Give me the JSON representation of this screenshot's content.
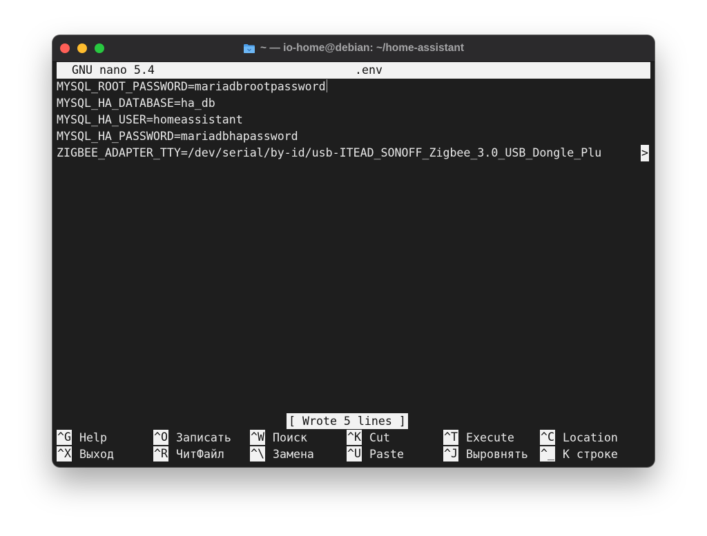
{
  "window": {
    "title": "~ — io-home@debian: ~/home-assistant",
    "title_icon": "folder-icon",
    "colors": {
      "close": "#ff5f57",
      "minimize": "#febc2e",
      "maximize": "#28c840"
    }
  },
  "nano": {
    "app": "GNU nano 5.4",
    "filename": ".env",
    "lines": [
      "MYSQL_ROOT_PASSWORD=mariadbrootpassword",
      "MYSQL_HA_DATABASE=ha_db",
      "MYSQL_HA_USER=homeassistant",
      "MYSQL_HA_PASSWORD=mariadbhapassword",
      "ZIGBEE_ADAPTER_TTY=/dev/serial/by-id/usb-ITEAD_SONOFF_Zigbee_3.0_USB_Dongle_Plu"
    ],
    "overflow_marker": ">",
    "status": "[ Wrote 5 lines ]",
    "shortcuts": [
      [
        {
          "key": "^G",
          "label": "Help"
        },
        {
          "key": "^O",
          "label": "Записать"
        },
        {
          "key": "^W",
          "label": "Поиск"
        },
        {
          "key": "^K",
          "label": "Cut"
        },
        {
          "key": "^T",
          "label": "Execute"
        },
        {
          "key": "^C",
          "label": "Location"
        }
      ],
      [
        {
          "key": "^X",
          "label": "Выход"
        },
        {
          "key": "^R",
          "label": "ЧитФайл"
        },
        {
          "key": "^\\",
          "label": "Замена"
        },
        {
          "key": "^U",
          "label": "Paste"
        },
        {
          "key": "^J",
          "label": "Выровнять"
        },
        {
          "key": "^_",
          "label": "К строке"
        }
      ]
    ]
  }
}
